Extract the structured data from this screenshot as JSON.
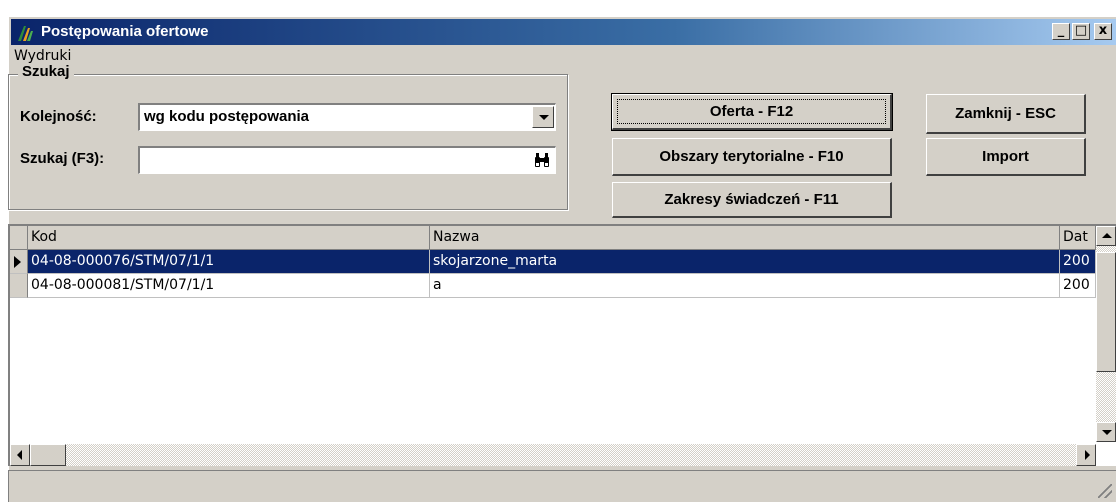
{
  "window": {
    "title": "Postępowania ofertowe",
    "controls": {
      "minimize": "_",
      "maximize": "□",
      "close": "x"
    }
  },
  "menu": {
    "items": [
      "Wydruki"
    ]
  },
  "search": {
    "group_title": "Szukaj",
    "order_label": "Kolejność:",
    "order_value": "wg kodu postępowania",
    "search_label": "Szukaj (F3):",
    "search_value": "",
    "search_icon": "binoculars-icon"
  },
  "buttons": {
    "offer": "Oferta - F12",
    "areas": "Obszary terytorialne - F10",
    "ranges": "Zakresy świadczeń - F11",
    "close": "Zamknij - ESC",
    "import": "Import"
  },
  "grid": {
    "columns": [
      "Kod",
      "Nazwa",
      "Dat"
    ],
    "rows": [
      {
        "kod": "04-08-000076/STM/07/1/1",
        "nazwa": "skojarzone_marta",
        "data": "200",
        "selected": true
      },
      {
        "kod": "04-08-000081/STM/07/1/1",
        "nazwa": "a",
        "data": "200",
        "selected": false
      }
    ]
  },
  "colors": {
    "selection": "#0a246a",
    "title_start": "#0a246a",
    "title_end": "#a6caf0",
    "face": "#d4d0c8"
  }
}
